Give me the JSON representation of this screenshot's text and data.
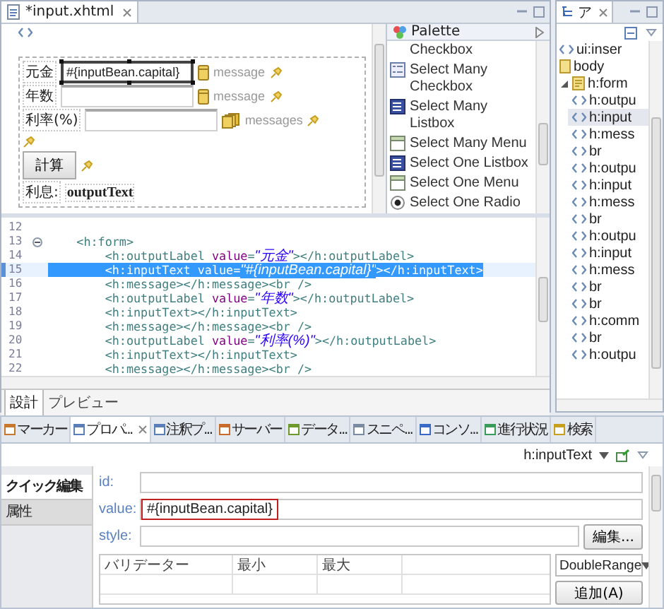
{
  "editor": {
    "tab": "*input.xhtml",
    "form": [
      {
        "kind": "field",
        "label": "元金",
        "value": "#{inputBean.capital}",
        "selected": true,
        "message": "message",
        "multiple": false
      },
      {
        "kind": "field",
        "label": "年数",
        "selected": false,
        "message": "message",
        "multiple": false
      },
      {
        "kind": "field",
        "label": "利率(%)",
        "selected": false,
        "message": "messages",
        "multiple": true
      },
      {
        "kind": "pin"
      },
      {
        "kind": "button",
        "label": "計算"
      },
      {
        "kind": "output",
        "label": "利息:",
        "value": "outputText"
      }
    ],
    "palette": {
      "title": "Palette",
      "items": [
        {
          "label": "Checkbox",
          "kind": "continued"
        },
        {
          "label": "Select Many Checkbox",
          "kind": "checklist"
        },
        {
          "label": "Select Many Listbox",
          "kind": "listbox"
        },
        {
          "label": "Select Many Menu",
          "kind": "menu"
        },
        {
          "label": "Select One Listbox",
          "kind": "listbox"
        },
        {
          "label": "Select One Menu",
          "kind": "menu"
        },
        {
          "label": "Select One Radio",
          "kind": "radio"
        }
      ]
    },
    "code": [
      {
        "number": "12",
        "selected": false,
        "foldable": false
      },
      {
        "number": "13",
        "selected": false,
        "foldable": true,
        "parts": [
          {
            "kind": "tag",
            "text": "    <h:form>"
          }
        ]
      },
      {
        "number": "14",
        "selected": false,
        "foldable": false,
        "parts": [
          {
            "kind": "tag",
            "text": "        <h:outputLabel "
          },
          {
            "kind": "attr",
            "text": "value"
          },
          {
            "kind": "tag",
            "text": "="
          },
          {
            "kind": "value",
            "text": "\"元金\""
          },
          {
            "kind": "tag",
            "text": "></h:outputLabel>"
          }
        ]
      },
      {
        "number": "15",
        "selected": true,
        "foldable": false,
        "parts": [
          {
            "kind": "tag",
            "text": "        <h:inputText "
          },
          {
            "kind": "attr",
            "text": "value"
          },
          {
            "kind": "tag",
            "text": "="
          },
          {
            "kind": "value",
            "text": "\"#{inputBean.capital}\""
          },
          {
            "kind": "tag",
            "text": "></h:inputText>"
          }
        ]
      },
      {
        "number": "16",
        "selected": false,
        "foldable": false,
        "parts": [
          {
            "kind": "tag",
            "text": "        <h:message></h:message><br />"
          }
        ]
      },
      {
        "number": "17",
        "selected": false,
        "foldable": false,
        "parts": [
          {
            "kind": "tag",
            "text": "        <h:outputLabel "
          },
          {
            "kind": "attr",
            "text": "value"
          },
          {
            "kind": "tag",
            "text": "="
          },
          {
            "kind": "value",
            "text": "\"年数\""
          },
          {
            "kind": "tag",
            "text": "></h:outputLabel>"
          }
        ]
      },
      {
        "number": "18",
        "selected": false,
        "foldable": false,
        "parts": [
          {
            "kind": "tag",
            "text": "        <h:inputText></h:inputText>"
          }
        ]
      },
      {
        "number": "19",
        "selected": false,
        "foldable": false,
        "parts": [
          {
            "kind": "tag",
            "text": "        <h:message></h:message><br />"
          }
        ]
      },
      {
        "number": "20",
        "selected": false,
        "foldable": false,
        "parts": [
          {
            "kind": "tag",
            "text": "        <h:outputLabel "
          },
          {
            "kind": "attr",
            "text": "value"
          },
          {
            "kind": "tag",
            "text": "="
          },
          {
            "kind": "value",
            "text": "\"利率(%)\""
          },
          {
            "kind": "tag",
            "text": "></h:outputLabel>"
          }
        ]
      },
      {
        "number": "21",
        "selected": false,
        "foldable": false,
        "parts": [
          {
            "kind": "tag",
            "text": "        <h:inputText></h:inputText>"
          }
        ]
      },
      {
        "number": "22",
        "selected": false,
        "foldable": false,
        "parts": [
          {
            "kind": "tag",
            "text": "        <h:message></h:message><br />"
          }
        ]
      }
    ],
    "page_tabs": [
      {
        "label": "設計",
        "selected": true
      },
      {
        "label": "プレビュー",
        "selected": false
      }
    ]
  },
  "outline": {
    "tab": "ア",
    "tree": [
      {
        "label": "ui:inser",
        "kind": "tag",
        "selected": false
      },
      {
        "label": "body",
        "kind": "file",
        "selected": false
      },
      {
        "label": "h:form",
        "kind": "form",
        "selected": false,
        "expanded": true,
        "children": [
          {
            "label": "h:outpu",
            "kind": "tag",
            "selected": false
          },
          {
            "label": "h:input",
            "kind": "tag",
            "selected": true
          },
          {
            "label": "h:mess",
            "kind": "tag",
            "selected": false
          },
          {
            "label": "br",
            "kind": "tag",
            "selected": false
          },
          {
            "label": "h:outpu",
            "kind": "tag",
            "selected": false
          },
          {
            "label": "h:input",
            "kind": "tag",
            "selected": false
          },
          {
            "label": "h:mess",
            "kind": "tag",
            "selected": false
          },
          {
            "label": "br",
            "kind": "tag",
            "selected": false
          },
          {
            "label": "h:outpu",
            "kind": "tag",
            "selected": false
          },
          {
            "label": "h:input",
            "kind": "tag",
            "selected": false
          },
          {
            "label": "h:mess",
            "kind": "tag",
            "selected": false
          },
          {
            "label": "br",
            "kind": "tag",
            "selected": false
          },
          {
            "label": "br",
            "kind": "tag",
            "selected": false
          },
          {
            "label": "h:comm",
            "kind": "tag",
            "selected": false
          },
          {
            "label": "br",
            "kind": "tag",
            "selected": false
          },
          {
            "label": "h:outpu",
            "kind": "tag",
            "selected": false
          }
        ]
      }
    ]
  },
  "panel_tabs": [
    {
      "label": "マーカー",
      "selected": false
    },
    {
      "label": "プロパ...",
      "selected": true
    },
    {
      "label": "注釈プ...",
      "selected": false
    },
    {
      "label": "サーバー",
      "selected": false
    },
    {
      "label": "データ...",
      "selected": false
    },
    {
      "label": "スニペ...",
      "selected": false
    },
    {
      "label": "コンソ...",
      "selected": false
    },
    {
      "label": "進行状況",
      "selected": false
    },
    {
      "label": "検索",
      "selected": false
    }
  ],
  "properties": {
    "element": "h:inputText",
    "side_tabs": [
      {
        "label": "クイック編集",
        "selected": true
      },
      {
        "label": "属性",
        "selected": false
      }
    ],
    "fields": [
      {
        "label": "id:",
        "highlighted": false
      },
      {
        "label": "value:",
        "value": "#{inputBean.capital}",
        "highlighted": true
      },
      {
        "label": "style:",
        "highlighted": false,
        "button": "編集..."
      }
    ],
    "validators": {
      "columns": [
        "バリデーター",
        "最小",
        "最大"
      ],
      "type": "DoubleRange",
      "add_button": "追加(A)"
    }
  }
}
